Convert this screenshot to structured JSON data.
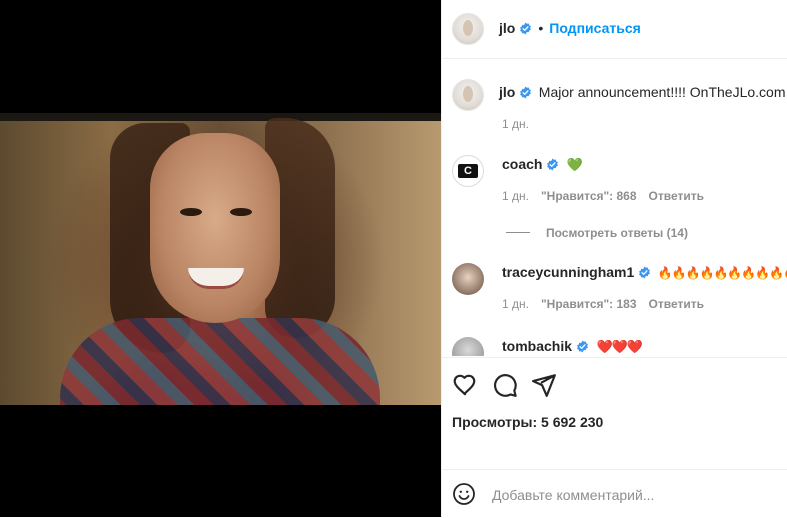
{
  "header": {
    "username": "jlo",
    "separator": "•",
    "follow_label": "Подписаться"
  },
  "caption": {
    "username": "jlo",
    "text": "Major announcement!!!! OnTheJLo.com",
    "time": "1 дн."
  },
  "comments": [
    {
      "username": "coach",
      "text": "💚",
      "time": "1 дн.",
      "likes_label": "\"Нравится\": 868",
      "reply_label": "Ответить",
      "view_replies_label": "Посмотреть ответы (14)"
    },
    {
      "username": "traceycunningham1",
      "text": "🔥🔥🔥🔥🔥🔥🔥🔥🔥🔥🔥🔥",
      "time": "1 дн.",
      "likes_label": "\"Нравится\": 183",
      "reply_label": "Ответить"
    },
    {
      "username": "tombachik",
      "text": "❤️❤️❤️"
    }
  ],
  "views_label": "Просмотры: 5 692 230",
  "add_comment": {
    "placeholder": "Добавьте комментарий..."
  },
  "icons": {
    "like": "heart-icon",
    "comment": "comment-icon",
    "share": "share-icon",
    "verified": "verified-badge-icon",
    "emoji": "emoji-icon"
  },
  "colors": {
    "accent": "#0095f6",
    "verified": "#3897f0",
    "muted": "#8e8e8e"
  }
}
